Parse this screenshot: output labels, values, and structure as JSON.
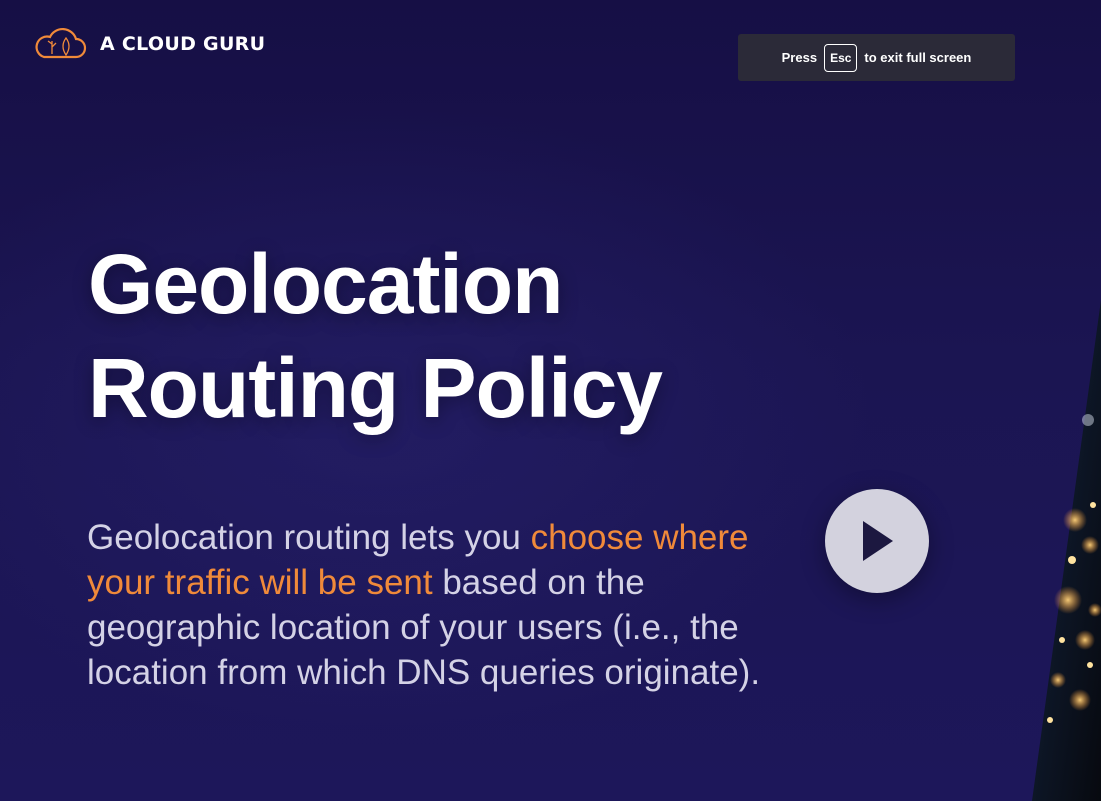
{
  "brand": {
    "name": "A CLOUD GURU",
    "icon": "cloud-logo-icon",
    "accent_color": "#f08a3a"
  },
  "fullscreen_notice": {
    "prefix": "Press",
    "key": "Esc",
    "suffix": "to exit full screen"
  },
  "slide": {
    "title_line1": "Geolocation",
    "title_line2": "Routing Policy",
    "body_part1": "Geolocation routing lets you ",
    "body_highlight": "choose where your traffic will be sent",
    "body_part2": " based on the geographic location of your users (i.e., the location from which DNS queries originate).",
    "highlight_color": "#f08a3a",
    "background_color": "#1b1550"
  },
  "player": {
    "play_icon": "play-icon"
  }
}
